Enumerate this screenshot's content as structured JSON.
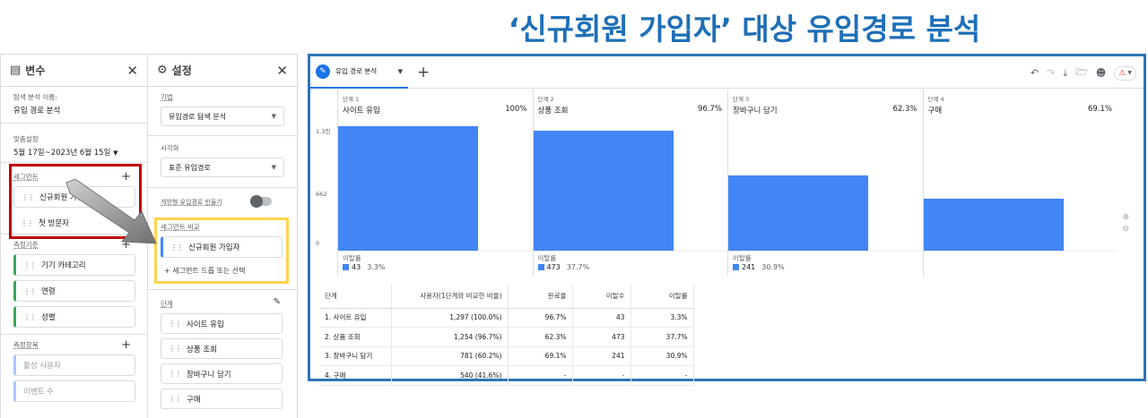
{
  "headline": "‘신규회원 가입자’ 대상 유입경로 분석",
  "variables_panel": {
    "title": "변수",
    "exploration_name_label": "탐색 분석 이름:",
    "exploration_name": "유입 경로 분석",
    "date_label": "맞춤설정",
    "date_range": "5월 17일~2023년 6월 15일",
    "segments_label": "세그먼트",
    "segments": [
      "신규회원 가입자",
      "첫 방문자"
    ],
    "dimensions_label": "측정기준",
    "dimensions": [
      "기기 카테고리",
      "연령",
      "성별"
    ],
    "metrics_label": "측정항목",
    "metrics": [
      "활성 사용자",
      "이벤트 수"
    ]
  },
  "settings_panel": {
    "title": "설정",
    "technique_label": "기법",
    "technique": "유입경로 탐색 분석",
    "visualization_label": "시각화",
    "visualization": "표준 유입경로",
    "open_funnel_label": "개방형 유입경로 만들기",
    "segment_compare_label": "세그먼트 비교",
    "segment_compare": [
      "신규회원 가입자"
    ],
    "drop_segment": "+ 세그먼트 드롭 또는 선택",
    "steps_label": "단계",
    "steps": [
      "사이트 유입",
      "상품 조회",
      "장바구니 담기",
      "구매"
    ]
  },
  "exploration": {
    "tab_label": "유입 경로 분석",
    "add_tab": "+",
    "y_ticks": [
      "1.3천",
      "662",
      "0"
    ],
    "drop_label": "이탈률",
    "zoom_in": "⊕",
    "zoom_out": "⊖",
    "warning_icon": "warning-icon",
    "table_headers": [
      "단계",
      "사용자(1단계와 비교한 비율)",
      "완료율",
      "이탈수",
      "이탈률"
    ],
    "table_rows": [
      [
        "1. 사이트 유입",
        "1,297 (100.0%)",
        "96.7%",
        "43",
        "3.3%"
      ],
      [
        "2. 상품 조회",
        "1,254 (96.7%)",
        "62.3%",
        "473",
        "37.7%"
      ],
      [
        "3. 장바구니 담기",
        "781 (60.2%)",
        "69.1%",
        "241",
        "30.9%"
      ],
      [
        "4. 구매",
        "540 (41.6%)",
        "-",
        "-",
        "-"
      ]
    ]
  },
  "chart_data": {
    "type": "bar",
    "categories": [
      "사이트 유입",
      "상품 조회",
      "장바구니 담기",
      "구매"
    ],
    "step_labels": [
      "단계 1",
      "단계 2",
      "단계 3",
      "단계 4"
    ],
    "percent_labels": [
      "100%",
      "96.7%",
      "62.3%",
      "69.1%"
    ],
    "values": [
      1297,
      1254,
      781,
      540
    ],
    "dropoff_counts": [
      43,
      473,
      241
    ],
    "dropoff_rates": [
      "3.3%",
      "37.7%",
      "30.9%"
    ],
    "ylim": [
      0,
      1300
    ],
    "yticks": [
      "0",
      "662",
      "1.3천"
    ],
    "bar_color": "#4285f4"
  },
  "colors": {
    "accent": "#1a73e8",
    "bar": "#4285f4",
    "headline": "#1e6fb8",
    "highlight_red": "#c00000",
    "highlight_yellow": "#ffd34d"
  }
}
